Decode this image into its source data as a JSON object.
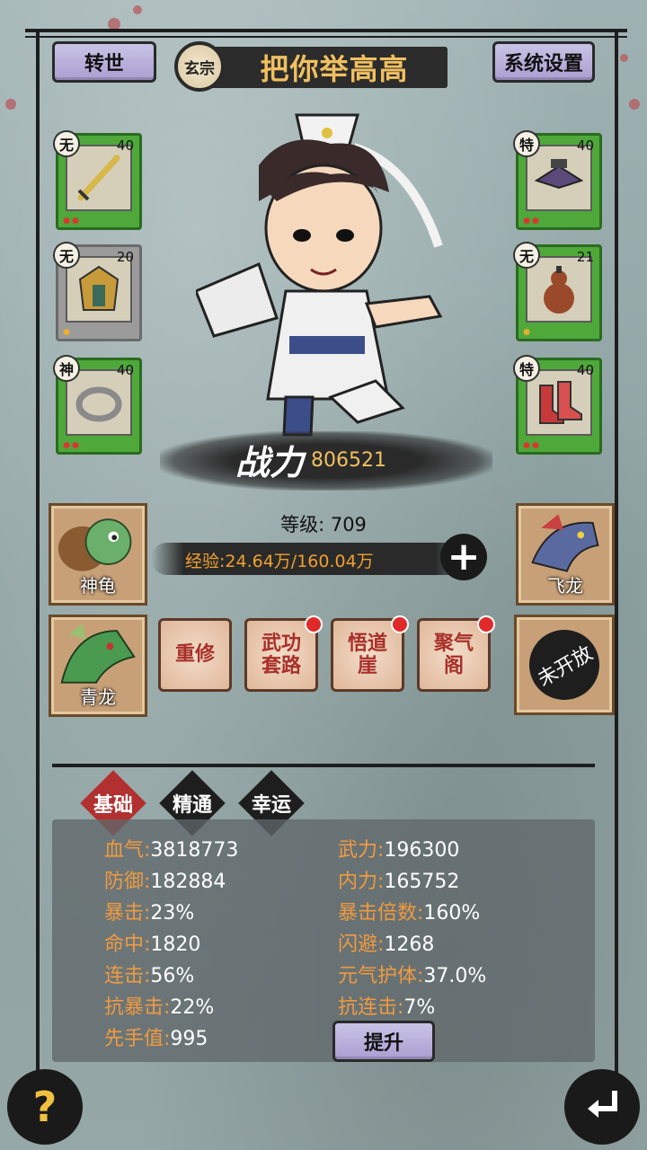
{
  "header": {
    "reincarnate_label": "转世",
    "sect_badge": "玄宗",
    "player_name": "把你举高高",
    "settings_label": "系统设置"
  },
  "equipment_left": [
    {
      "tag": "无",
      "level": "40",
      "item": "sword-icon",
      "stars": "✸✸"
    },
    {
      "tag": "无",
      "level": "20",
      "item": "armor-icon",
      "stars": "✸"
    },
    {
      "tag": "神",
      "level": "40",
      "item": "ring-icon",
      "stars": "✸✸"
    }
  ],
  "equipment_right": [
    {
      "tag": "特",
      "level": "40",
      "item": "hat-icon",
      "stars": "✸✸"
    },
    {
      "tag": "无",
      "level": "21",
      "item": "gourd-icon",
      "stars": "✸"
    },
    {
      "tag": "特",
      "level": "40",
      "item": "boots-icon",
      "stars": "✸✸"
    }
  ],
  "power": {
    "label": "战力",
    "value": "806521"
  },
  "level": {
    "text": "等级: 709"
  },
  "exp": {
    "text": "经验:24.64万/160.04万",
    "add_label": "+"
  },
  "beasts": [
    {
      "name": "神龟"
    },
    {
      "name": "飞龙"
    },
    {
      "name": "青龙"
    }
  ],
  "functions": [
    {
      "label": "重修",
      "badge": false
    },
    {
      "label": "武功套路",
      "badge": true
    },
    {
      "label": "悟道崖",
      "badge": true
    },
    {
      "label": "聚气阁",
      "badge": true
    }
  ],
  "locked_slot": {
    "label": "未开放"
  },
  "tabs": [
    {
      "label": "基础",
      "active": true
    },
    {
      "label": "精通",
      "active": false
    },
    {
      "label": "幸运",
      "active": false
    }
  ],
  "stats_left": [
    {
      "key": "血气:",
      "value": "3818773"
    },
    {
      "key": "防御:",
      "value": "182884"
    },
    {
      "key": "暴击:",
      "value": "23%"
    },
    {
      "key": "命中:",
      "value": "1820"
    },
    {
      "key": "连击:",
      "value": "56%"
    },
    {
      "key": "抗暴击:",
      "value": "22%"
    },
    {
      "key": "先手值:",
      "value": "995"
    }
  ],
  "stats_right": [
    {
      "key": "武力:",
      "value": "196300"
    },
    {
      "key": "内力:",
      "value": "165752"
    },
    {
      "key": "暴击倍数:",
      "value": "160%"
    },
    {
      "key": "闪避:",
      "value": "1268"
    },
    {
      "key": "元气护体:",
      "value": "37.0%"
    },
    {
      "key": "抗连击:",
      "value": "7%"
    }
  ],
  "raise_label": "提升",
  "footer": {
    "help_label": "?",
    "back_icon": "return-arrow-icon"
  },
  "colors": {
    "stat_key": "#f09a40",
    "gold": "#f0c060",
    "slot_green": "#4ea83a",
    "slot_gray": "#9b9b9b",
    "red_tab": "#b23030"
  }
}
